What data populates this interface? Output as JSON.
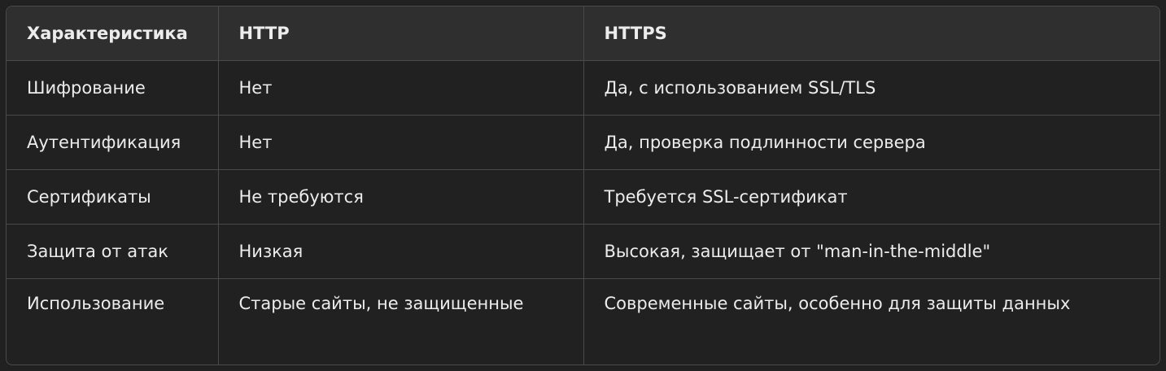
{
  "table": {
    "headers": [
      "Характеристика",
      "HTTP",
      "HTTPS"
    ],
    "rows": [
      [
        "Шифрование",
        "Нет",
        "Да, с использованием SSL/TLS"
      ],
      [
        "Аутентификация",
        "Нет",
        "Да, проверка подлинности сервера"
      ],
      [
        "Сертификаты",
        "Не требуются",
        "Требуется SSL-сертификат"
      ],
      [
        "Защита от атак",
        "Низкая",
        "Высокая, защищает от \"man-in-the-middle\""
      ],
      [
        "Использование",
        "Старые сайты, не защищенные",
        "Современные сайты, особенно для защиты данных"
      ]
    ]
  },
  "colors": {
    "background": "#212121",
    "header_background": "#2f2f2f",
    "border": "#4a4a4a",
    "text": "#ececec"
  }
}
